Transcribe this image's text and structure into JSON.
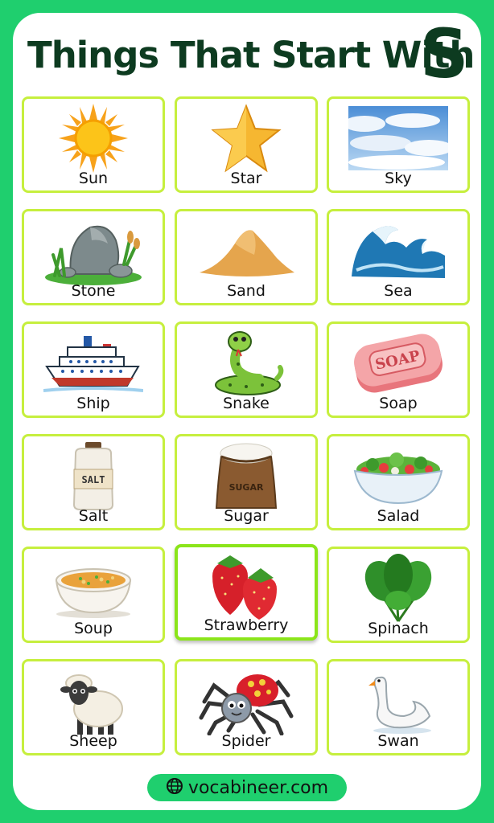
{
  "title": "Things That Start With",
  "letter": "S",
  "items": [
    {
      "label": "Sun",
      "icon": "sun-icon"
    },
    {
      "label": "Star",
      "icon": "star-icon"
    },
    {
      "label": "Sky",
      "icon": "sky-icon"
    },
    {
      "label": "Stone",
      "icon": "stone-icon"
    },
    {
      "label": "Sand",
      "icon": "sand-icon"
    },
    {
      "label": "Sea",
      "icon": "sea-wave-icon"
    },
    {
      "label": "Ship",
      "icon": "ship-icon"
    },
    {
      "label": "Snake",
      "icon": "snake-icon"
    },
    {
      "label": "Soap",
      "icon": "soap-icon",
      "printed": "SOAP"
    },
    {
      "label": "Salt",
      "icon": "salt-jar-icon",
      "printed": "SALT"
    },
    {
      "label": "Sugar",
      "icon": "sugar-sack-icon",
      "printed": "SUGAR"
    },
    {
      "label": "Salad",
      "icon": "salad-icon"
    },
    {
      "label": "Soup",
      "icon": "soup-icon"
    },
    {
      "label": "Strawberry",
      "icon": "strawberry-icon"
    },
    {
      "label": "Spinach",
      "icon": "spinach-icon"
    },
    {
      "label": "Sheep",
      "icon": "sheep-icon"
    },
    {
      "label": "Spider",
      "icon": "spider-icon"
    },
    {
      "label": "Swan",
      "icon": "swan-icon"
    }
  ],
  "footer": {
    "text": "vocabineer.com",
    "icon": "globe-icon"
  },
  "colors": {
    "background": "#1fcf6e",
    "title": "#0d3b20",
    "card_border": "#c6ef3e"
  }
}
